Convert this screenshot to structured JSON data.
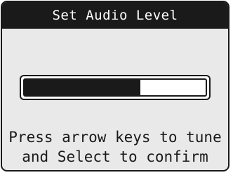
{
  "dialog": {
    "title": "Set Audio Level"
  },
  "audio_level": {
    "level_fraction": 0.64
  },
  "instructions": {
    "line1": "Press arrow keys to tune",
    "line2": "and Select to confirm"
  }
}
